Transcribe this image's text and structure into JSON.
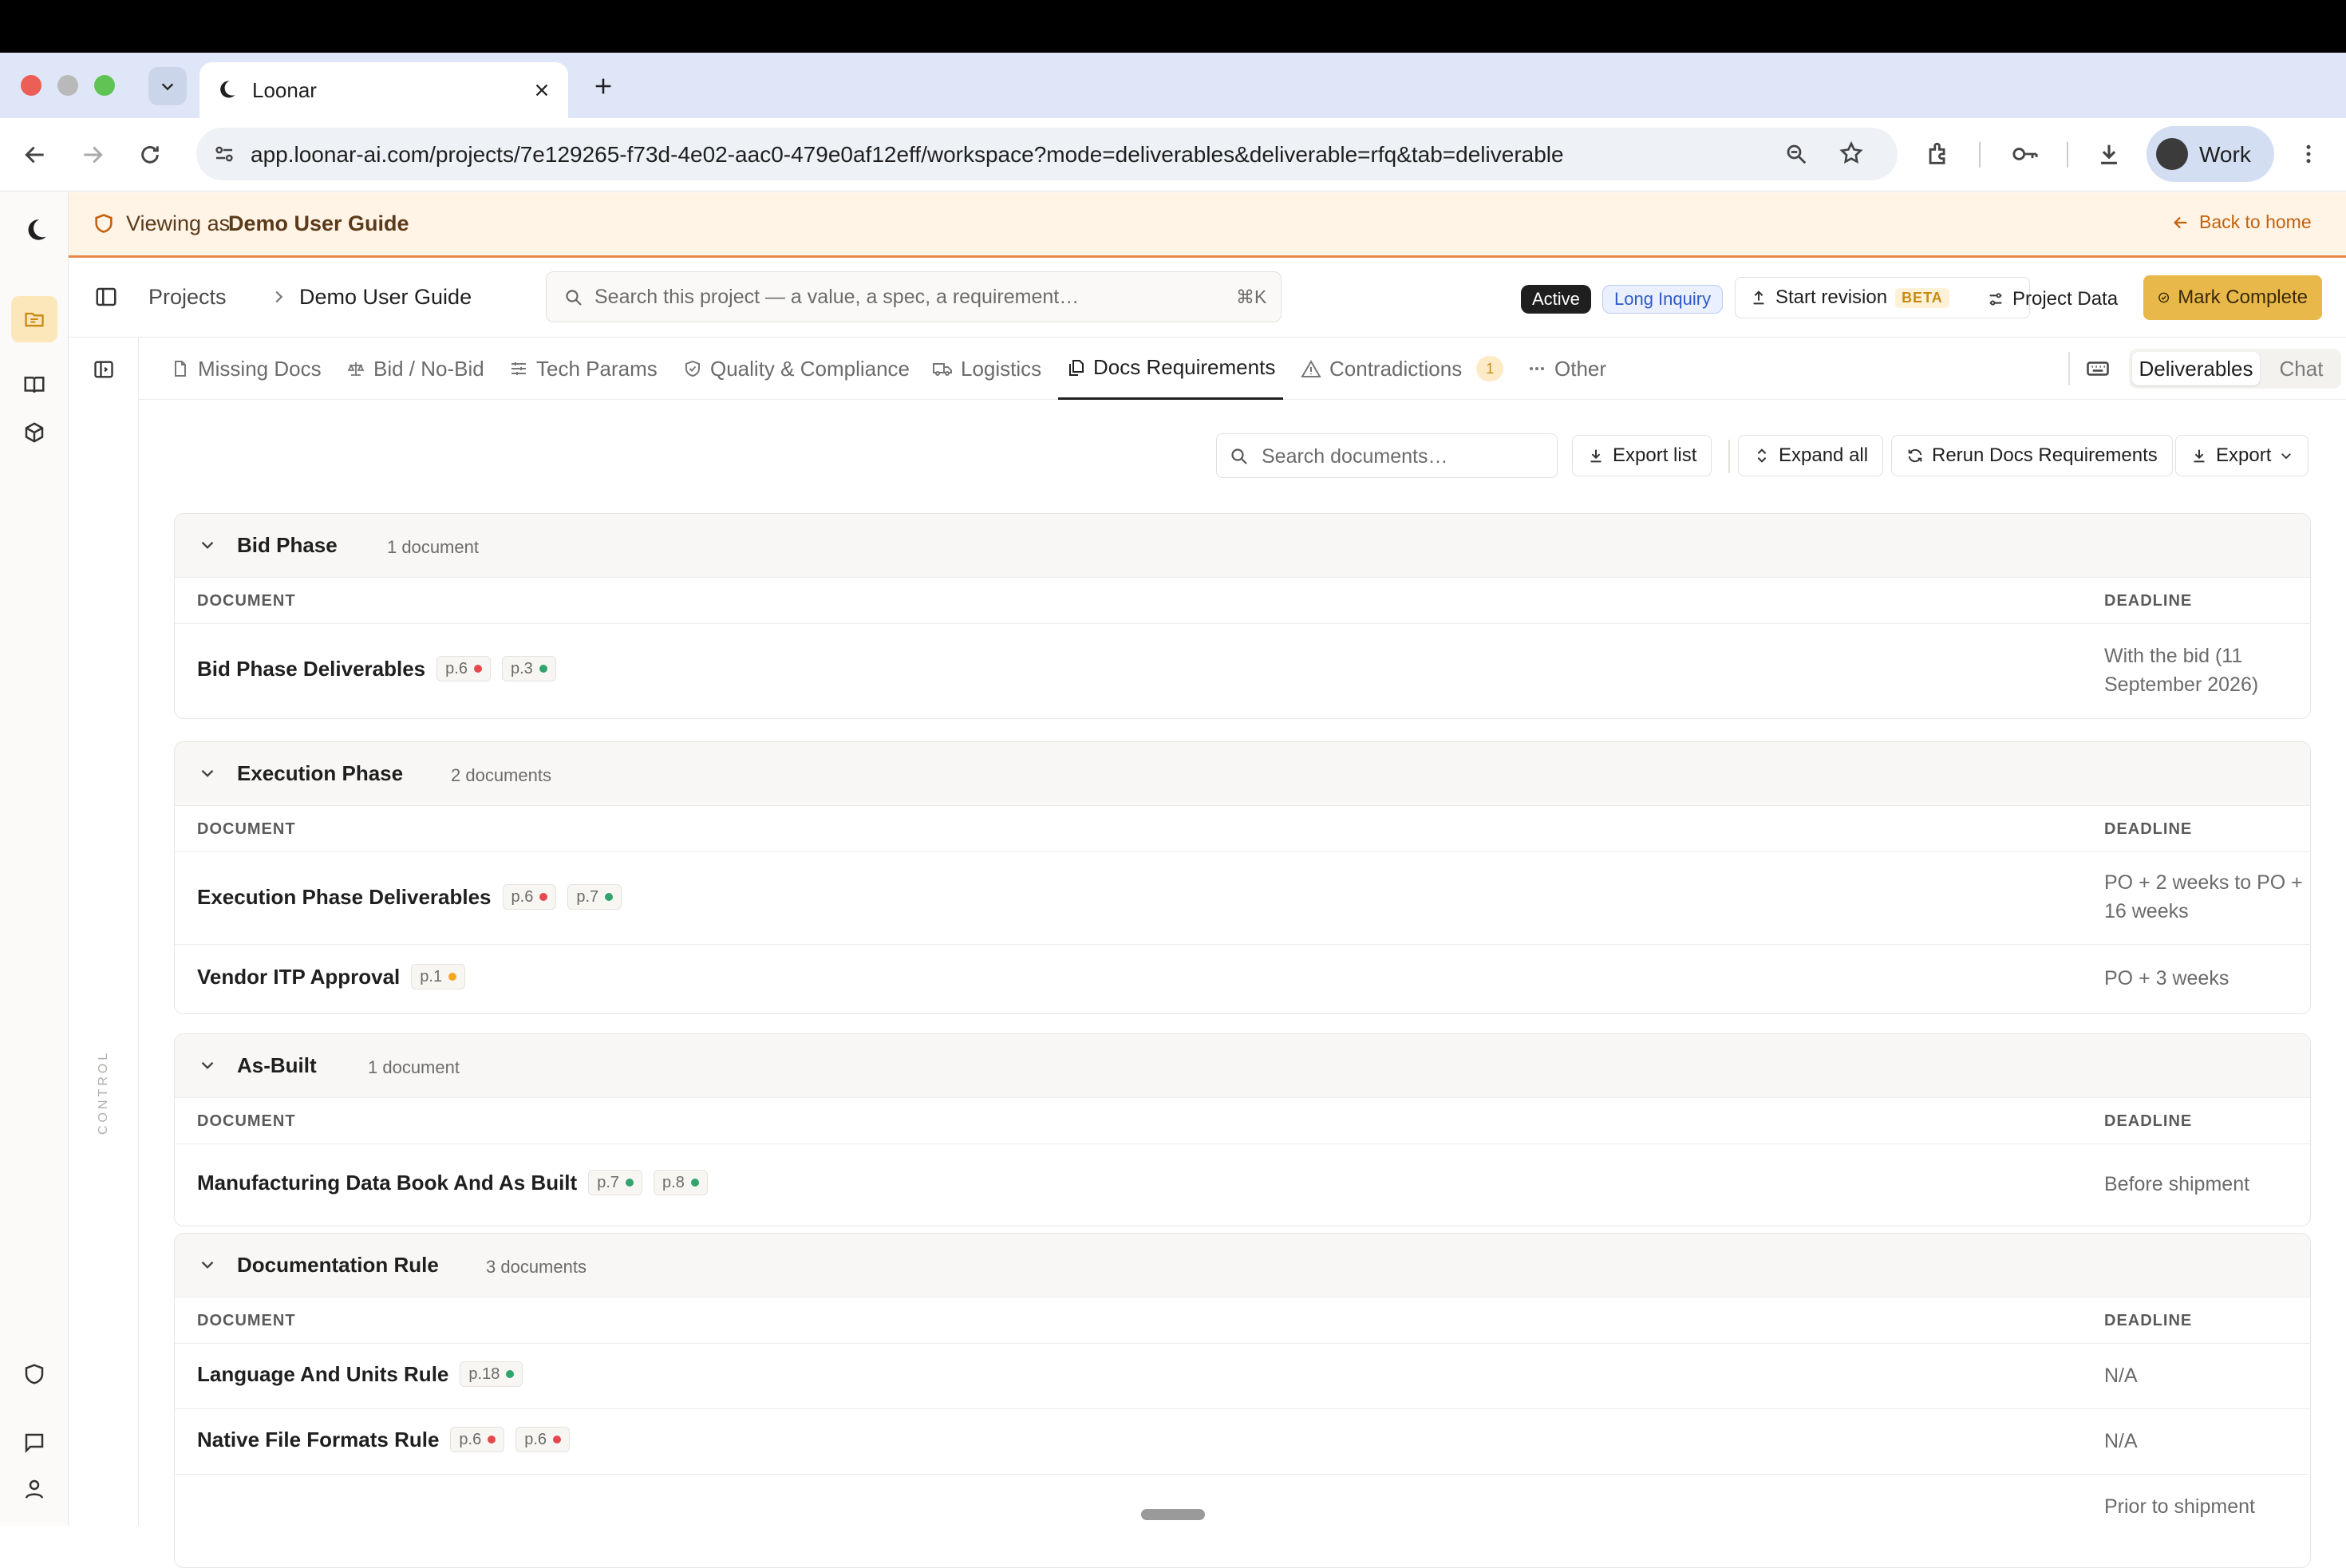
{
  "browser": {
    "tab_title": "Loonar",
    "url": "app.loonar-ai.com/projects/7e129265-f73d-4e02-aac0-479e0af12eff/workspace?mode=deliverables&deliverable=rfq&tab=deliverable",
    "profile_label": "Work"
  },
  "banner": {
    "prefix": "Viewing as",
    "user": "Demo User Guide",
    "back_label": "Back to home"
  },
  "header": {
    "breadcrumb": [
      "Projects",
      "Demo User Guide"
    ],
    "search_placeholder": "Search this project — a value, a spec, a requirement…",
    "search_shortcut": "⌘K",
    "status_badge": "Active",
    "type_badge": "Long Inquiry",
    "start_revision_label": "Start revision",
    "beta_label": "BETA",
    "project_data_label": "Project Data",
    "mark_complete_label": "Mark Complete"
  },
  "side_label": "CONTROL",
  "tabs": [
    {
      "label": "Missing Docs",
      "icon": "file-icon"
    },
    {
      "label": "Bid / No-Bid",
      "icon": "scale-icon"
    },
    {
      "label": "Tech Params",
      "icon": "sliders-icon"
    },
    {
      "label": "Quality & Compliance",
      "icon": "shield-check-icon"
    },
    {
      "label": "Logistics",
      "icon": "truck-icon"
    },
    {
      "label": "Docs Requirements",
      "icon": "documents-icon",
      "active": true
    },
    {
      "label": "Contradictions",
      "icon": "warning-icon",
      "badge": "1"
    },
    {
      "label": "Other",
      "icon": "more-icon"
    }
  ],
  "view_toggle": {
    "deliverables": "Deliverables",
    "chat": "Chat"
  },
  "toolbar": {
    "search_placeholder": "Search documents…",
    "export_list": "Export list",
    "expand_all": "Expand all",
    "rerun": "Rerun Docs Requirements",
    "export": "Export"
  },
  "columns": {
    "document": "DOCUMENT",
    "deadline": "DEADLINE"
  },
  "sections": [
    {
      "title": "Bid Phase",
      "count": "1 document",
      "rows": [
        {
          "name": "Bid Phase Deliverables",
          "refs": [
            {
              "page": "p.6",
              "status": "red"
            },
            {
              "page": "p.3",
              "status": "green"
            }
          ],
          "deadline": "With the bid (11 September 2026)"
        }
      ]
    },
    {
      "title": "Execution Phase",
      "count": "2 documents",
      "rows": [
        {
          "name": "Execution Phase Deliverables",
          "refs": [
            {
              "page": "p.6",
              "status": "red"
            },
            {
              "page": "p.7",
              "status": "green"
            }
          ],
          "deadline": "PO + 2 weeks to PO + 16 weeks"
        },
        {
          "name": "Vendor ITP Approval",
          "refs": [
            {
              "page": "p.1",
              "status": "orange"
            }
          ],
          "deadline": "PO + 3 weeks"
        }
      ]
    },
    {
      "title": "As-Built",
      "count": "1 document",
      "rows": [
        {
          "name": "Manufacturing Data Book And As Built",
          "refs": [
            {
              "page": "p.7",
              "status": "green"
            },
            {
              "page": "p.8",
              "status": "green"
            }
          ],
          "deadline": "Before shipment"
        }
      ]
    },
    {
      "title": "Documentation Rule",
      "count": "3 documents",
      "rows": [
        {
          "name": "Language And Units Rule",
          "refs": [
            {
              "page": "p.18",
              "status": "green"
            }
          ],
          "deadline": "N/A"
        },
        {
          "name": "Native File Formats Rule",
          "refs": [
            {
              "page": "p.6",
              "status": "red"
            },
            {
              "page": "p.6",
              "status": "red"
            }
          ],
          "deadline": "N/A"
        },
        {
          "name": "",
          "refs": [],
          "deadline": "Prior to shipment"
        }
      ]
    }
  ],
  "colors": {
    "red": "#e5484d",
    "green": "#30a46c",
    "orange": "#f5a623",
    "accent": "#e8b84a"
  }
}
